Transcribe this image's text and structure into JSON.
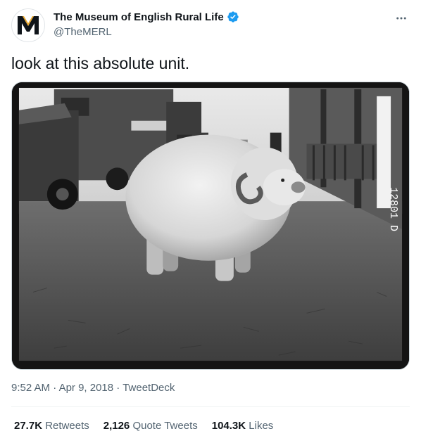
{
  "author": {
    "display_name": "The Museum of English Rural Life",
    "handle": "@TheMERL",
    "avatar_icon": "merl-m-logo-icon",
    "verified_icon": "verified-badge-icon",
    "verified_color": "#1d9bf0"
  },
  "more_icon": "more-options-icon",
  "tweet": {
    "text": "look at this absolute unit.",
    "media_icon": "ram-photo",
    "photo_inscription": "12801 D"
  },
  "meta": {
    "time": "9:52 AM",
    "separator": "·",
    "date": "Apr 9, 2018",
    "source": "TweetDeck"
  },
  "stats": {
    "retweets_count": "27.7K",
    "retweets_label": "Retweets",
    "quotes_count": "2,126",
    "quotes_label": "Quote Tweets",
    "likes_count": "104.3K",
    "likes_label": "Likes"
  },
  "colors": {
    "text_primary": "#0f1419",
    "text_secondary": "#536471",
    "divider": "#eff3f4"
  }
}
